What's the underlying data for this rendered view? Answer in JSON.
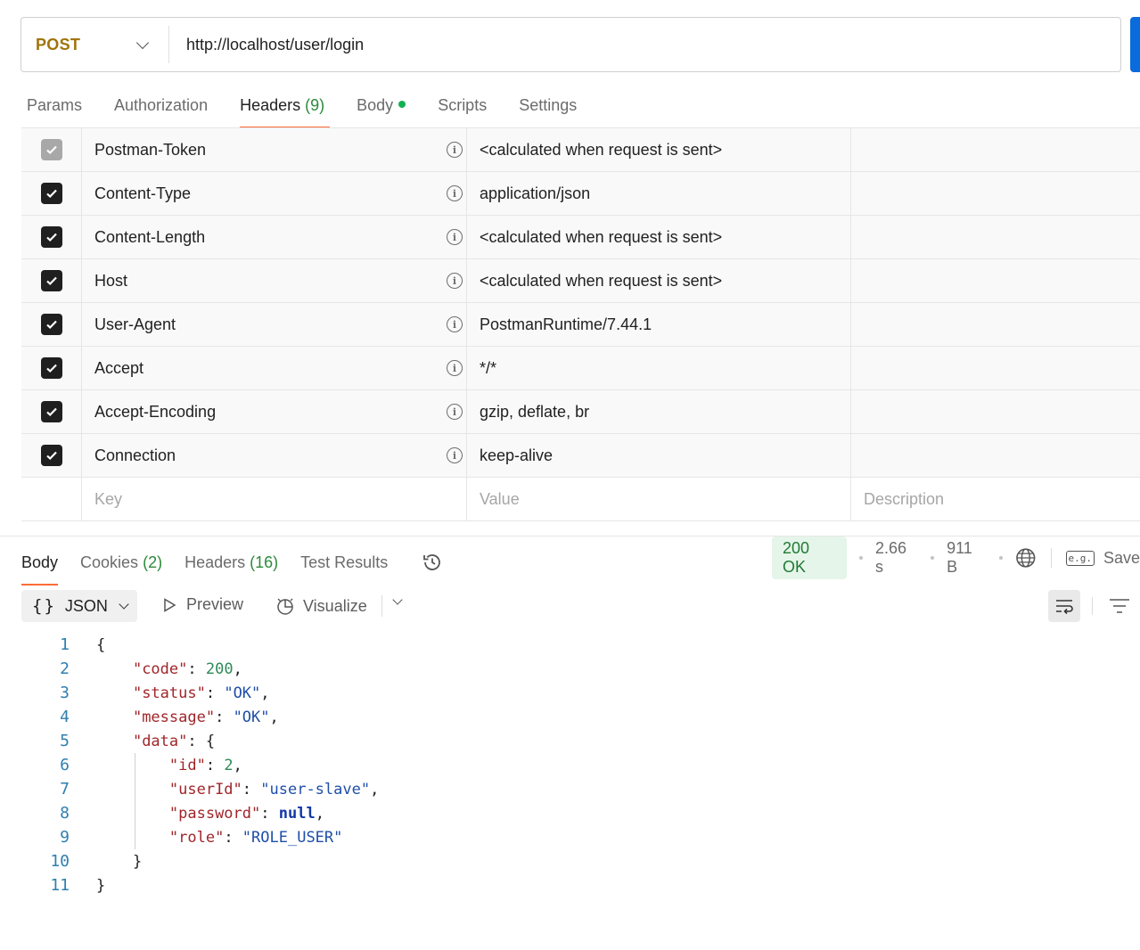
{
  "request": {
    "method": "POST",
    "url": "http://localhost/user/login"
  },
  "request_tabs": [
    {
      "label": "Params"
    },
    {
      "label": "Authorization"
    },
    {
      "label": "Headers",
      "count": "(9)",
      "active": true
    },
    {
      "label": "Body",
      "has_dot": true
    },
    {
      "label": "Scripts"
    },
    {
      "label": "Settings"
    }
  ],
  "headers": [
    {
      "key": "Postman-Token",
      "value": "<calculated when request is sent>",
      "checked": true,
      "disabled": true
    },
    {
      "key": "Content-Type",
      "value": "application/json",
      "checked": true
    },
    {
      "key": "Content-Length",
      "value": "<calculated when request is sent>",
      "checked": true
    },
    {
      "key": "Host",
      "value": "<calculated when request is sent>",
      "checked": true
    },
    {
      "key": "User-Agent",
      "value": "PostmanRuntime/7.44.1",
      "checked": true
    },
    {
      "key": "Accept",
      "value": "*/*",
      "checked": true
    },
    {
      "key": "Accept-Encoding",
      "value": "gzip, deflate, br",
      "checked": true
    },
    {
      "key": "Connection",
      "value": "keep-alive",
      "checked": true
    }
  ],
  "new_header": {
    "key_placeholder": "Key",
    "value_placeholder": "Value",
    "description_placeholder": "Description"
  },
  "response_tabs": [
    {
      "label": "Body",
      "active": true
    },
    {
      "label": "Cookies",
      "count": "(2)"
    },
    {
      "label": "Headers",
      "count": "(16)"
    },
    {
      "label": "Test Results"
    }
  ],
  "response_meta": {
    "status": "200 OK",
    "time": "2.66 s",
    "size": "911 B",
    "save_label": "Save"
  },
  "response_toolbar": {
    "format": "JSON",
    "preview": "Preview",
    "visualize": "Visualize"
  },
  "response_body_lines": [
    "1",
    "2",
    "3",
    "4",
    "5",
    "6",
    "7",
    "8",
    "9",
    "10",
    "11"
  ],
  "response_json": {
    "code": "200",
    "status": "\"OK\"",
    "message": "\"OK\"",
    "id": "2",
    "userId": "\"user-slave\"",
    "password": "null",
    "role": "\"ROLE_USER\""
  },
  "colors": {
    "method": "#a0740a",
    "active_tab_underline": "#ff6c37",
    "status_ok_bg": "#e6f5ea",
    "status_ok_text": "#1f7a33",
    "send_button": "#0a6bdc"
  }
}
